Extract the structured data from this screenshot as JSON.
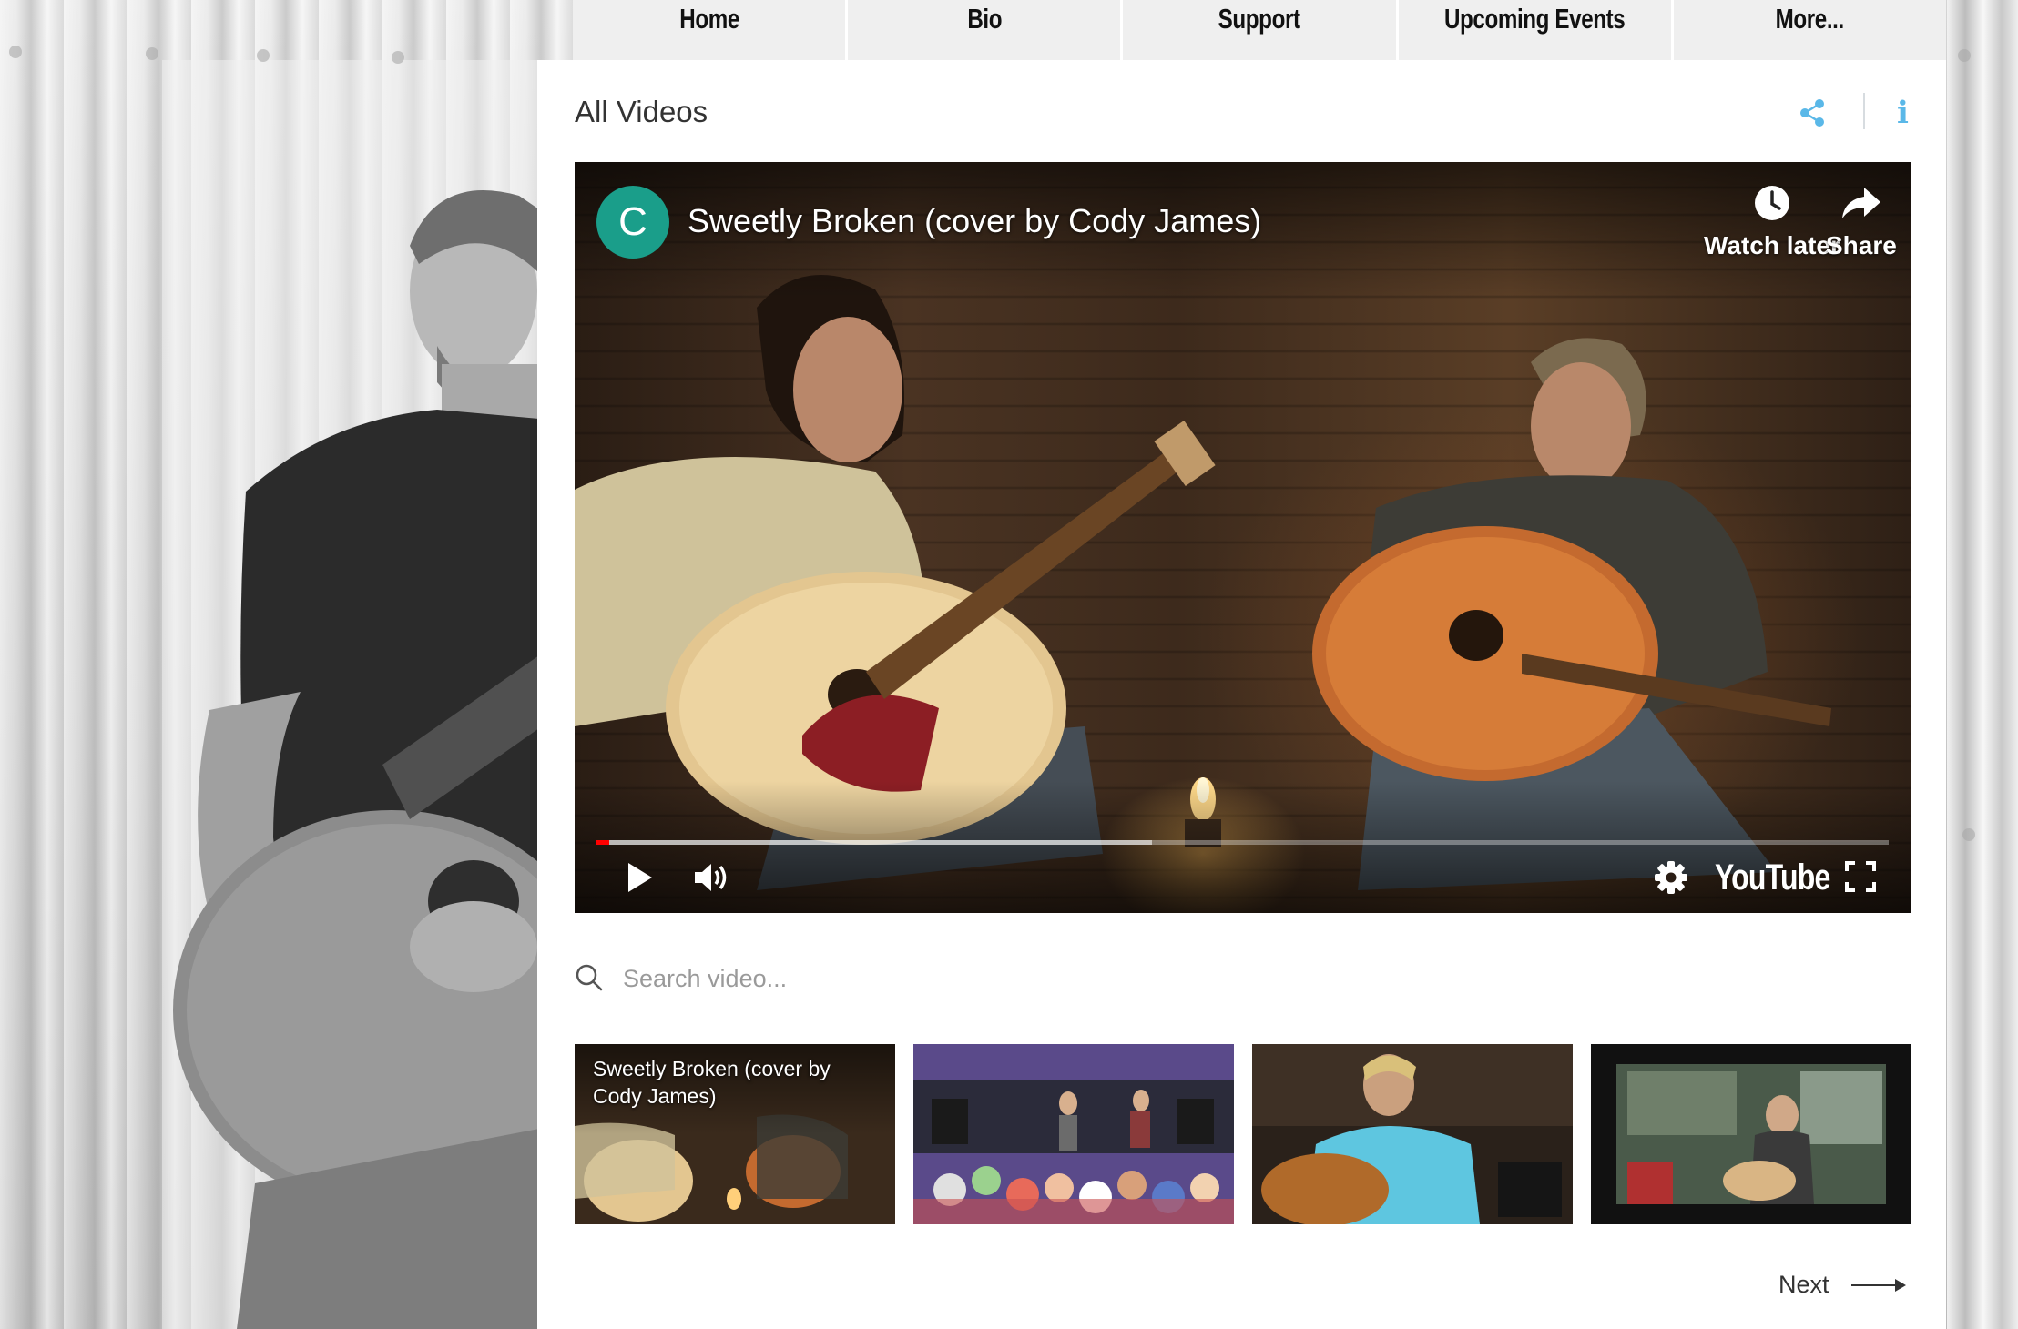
{
  "nav": {
    "items": [
      {
        "label": "Home"
      },
      {
        "label": "Bio"
      },
      {
        "label": "Support"
      },
      {
        "label": "Upcoming Events"
      },
      {
        "label": "More..."
      }
    ]
  },
  "gallery": {
    "title": "All Videos",
    "share_icon": "share-icon",
    "info_icon": "info-icon",
    "info_glyph": "i",
    "accent_color": "#5ab8e8"
  },
  "player": {
    "channel_initial": "C",
    "channel_color": "#1a9e8a",
    "video_title": "Sweetly Broken (cover by Cody James)",
    "watch_later_label": "Watch later",
    "share_label": "Share",
    "progress_played": 0.01,
    "progress_buffered": 0.43,
    "brand_label": "YouTube",
    "controls": [
      "play-icon",
      "volume-icon",
      "settings-icon",
      "fullscreen-icon"
    ]
  },
  "search": {
    "placeholder": "Search video..."
  },
  "thumbnails": [
    {
      "title": "Sweetly Broken (cover by Cody James)"
    },
    {
      "title": ""
    },
    {
      "title": ""
    },
    {
      "title": ""
    }
  ],
  "pagination": {
    "next_label": "Next"
  }
}
